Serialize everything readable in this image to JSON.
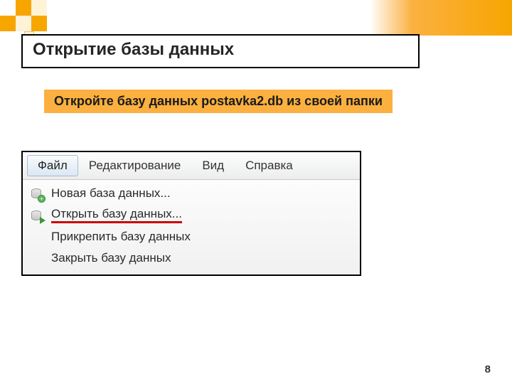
{
  "slide": {
    "title": "Открытие базы данных",
    "instruction": "Откройте базу данных  postavka2.db из своей папки",
    "page_number": "8"
  },
  "menu": {
    "bar": {
      "file": "Файл",
      "edit": "Редактирование",
      "view": "Вид",
      "help": "Справка"
    },
    "dropdown": {
      "new_db": "Новая база данных...",
      "open_db": "Открыть базу данных...",
      "attach_db": "Прикрепить базу данных",
      "close_db": "Закрыть базу данных"
    }
  }
}
